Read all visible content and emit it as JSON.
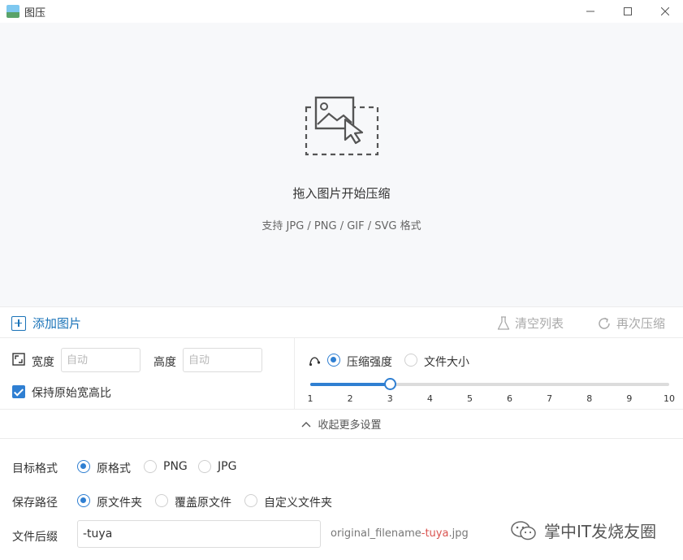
{
  "window": {
    "title": "图压"
  },
  "dropzone": {
    "title": "拖入图片开始压缩",
    "subtitle": "支持 JPG / PNG / GIF / SVG 格式"
  },
  "toolbar": {
    "add_label": "添加图片",
    "clear_label": "清空列表",
    "recompress_label": "再次压缩"
  },
  "size": {
    "width_label": "宽度",
    "width_placeholder": "自动",
    "height_label": "高度",
    "height_placeholder": "自动",
    "keep_ratio_label": "保持原始宽高比",
    "keep_ratio_checked": true
  },
  "compress": {
    "mode_strength_label": "压缩强度",
    "mode_filesize_label": "文件大小",
    "selected_mode": "压缩强度",
    "slider_value": 3,
    "slider_min": 1,
    "slider_max": 10,
    "ticks": [
      "1",
      "2",
      "3",
      "4",
      "5",
      "6",
      "7",
      "8",
      "9",
      "10"
    ]
  },
  "collapse": {
    "label": "收起更多设置"
  },
  "format": {
    "label": "目标格式",
    "options": [
      "原格式",
      "PNG",
      "JPG"
    ],
    "selected": "原格式"
  },
  "save_path": {
    "label": "保存路径",
    "options": [
      "原文件夹",
      "覆盖原文件",
      "自定义文件夹"
    ],
    "selected": "原文件夹"
  },
  "suffix": {
    "label": "文件后缀",
    "value": "-tuya",
    "hint_prefix": "original_filename",
    "hint_suffix": "-tuya",
    "hint_ext": ".jpg"
  },
  "watermark": {
    "text": "掌中IT发烧友圈"
  },
  "colors": {
    "accent": "#2f7fd2",
    "link": "#1a73b8",
    "disabled": "#a9a9a9",
    "suffix_red": "#d9534f",
    "dropzone_bg": "#f7f8fa"
  }
}
